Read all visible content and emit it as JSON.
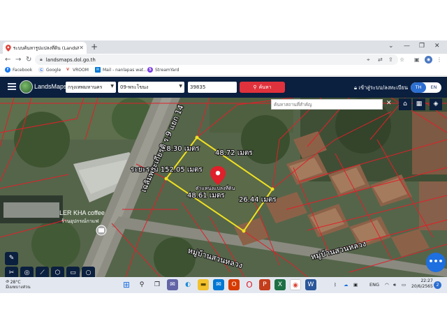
{
  "browser": {
    "tab_title": "ระบบค้นหารูปแปลงที่ดิน (LandsMaps)",
    "url": "landsmaps.dol.go.th",
    "bookmarks": [
      "Facebook",
      "Google",
      "VROOM",
      "Mail - nanlapas wat...",
      "StreamYard"
    ]
  },
  "app": {
    "brand": "LandsMaps",
    "province": "กรุงเทพมหานคร",
    "district": "09-พระโขนง",
    "parcel_no": "39835",
    "search_label": "ค้นหา",
    "login_label": "เข้าสู่ระบบ/ลงทะเบียน",
    "lang_th": "TH",
    "lang_en": "EN",
    "map_search_placeholder": "ค้นหาสถานที่สำคัญ"
  },
  "map": {
    "parcel_edges": [
      "28.30 เมตร",
      "48.72 เมตร",
      "26.44 เมตร",
      "48.61 เมตร"
    ],
    "pin_label": "ตำแหน่งแปลงที่ดิน",
    "distance_label": "ระยะรวม 152.05 เมตร",
    "road_north": "เฉลิมพระเกียรติ ร.9 แยก 14",
    "road_south": "หมู่บ้านสวนหลวง",
    "poi_name": "LER KHA coffee",
    "poi_sub": "ร้านอุปกรณ์กาแฟ",
    "colors": {
      "parcel_outline": "#f0e020",
      "cadastral_lines": "#e0202a",
      "pin": "#e0202a",
      "toolbar": "#0b1f3f",
      "search_button": "#e0323c"
    }
  },
  "taskbar": {
    "weather_temp": "28°C",
    "weather_text": "มีเมฆบางส่วน",
    "language": "ENG",
    "time": "22:27",
    "date": "20/6/2565",
    "notifications": "2"
  }
}
